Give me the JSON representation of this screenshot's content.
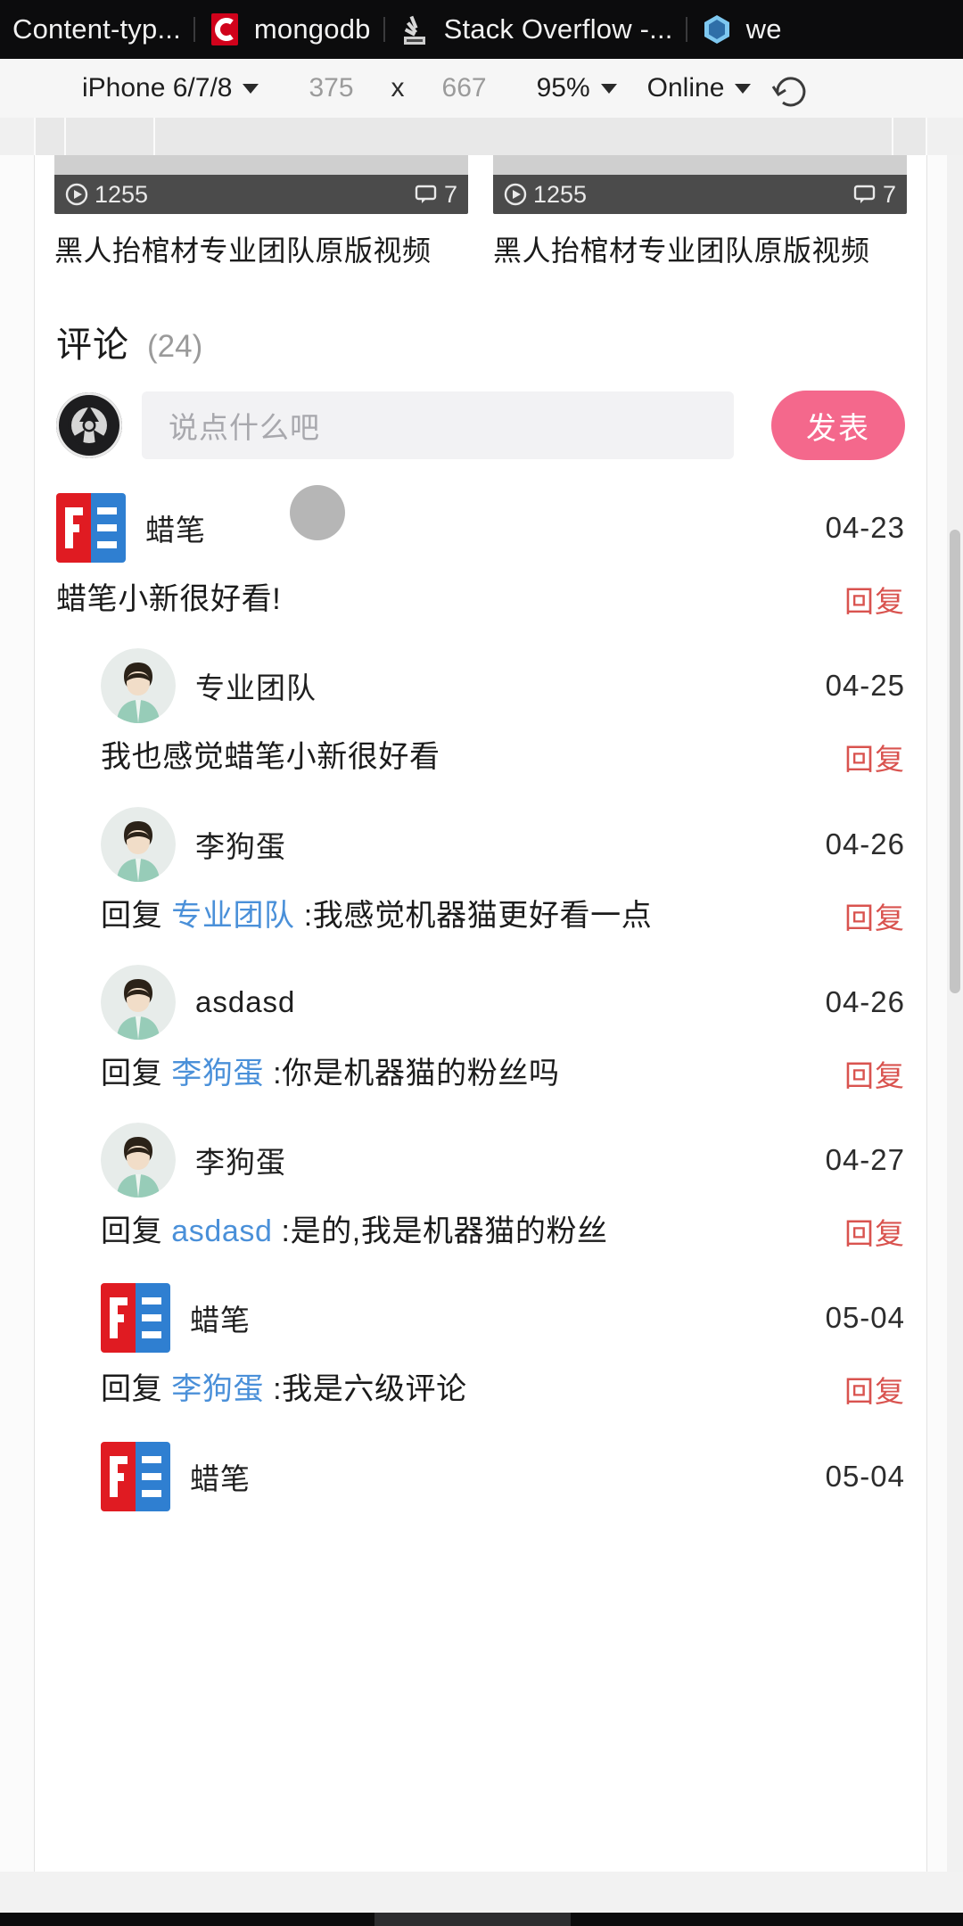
{
  "browser": {
    "tabs": [
      {
        "title": "Content-typ...",
        "favicon": "generic-page-icon"
      },
      {
        "title": "mongodb",
        "favicon": "mongodb-red-c-icon"
      },
      {
        "title": "Stack Overflow -...",
        "favicon": "stack-overflow-icon"
      },
      {
        "title": "we",
        "favicon": "blue-cube-icon"
      }
    ]
  },
  "device_toolbar": {
    "device_label": "iPhone 6/7/8",
    "width": "375",
    "separator": "x",
    "height": "667",
    "zoom": "95%",
    "throttling": "Online",
    "rotate_icon": "rotate-device-icon"
  },
  "page": {
    "videos": [
      {
        "title": "黑人抬棺材专业团队原版视频",
        "plays": "1255",
        "comments": "7"
      },
      {
        "title": "黑人抬棺材专业团队原版视频",
        "plays": "1255",
        "comments": "7"
      }
    ],
    "comments_header": {
      "label": "评论",
      "count": "(24)"
    },
    "composer": {
      "placeholder": "说点什么吧",
      "value": "",
      "submit_label": "发表",
      "submit_color": "#f4688c",
      "avatar": "site-logo-avatar"
    },
    "reply_label": "回复",
    "reply_prefix": "回复",
    "reply_color": "#d9534f",
    "mention_color": "#4a90d9",
    "comments": [
      {
        "level": 0,
        "avatar": "fe-logo-avatar",
        "name": "蜡笔",
        "date": "04-23",
        "prefix": "",
        "mention": "",
        "text": "蜡笔小新很好看!",
        "reply": "回复",
        "loading_dot": true
      },
      {
        "level": 1,
        "avatar": "default-user-avatar",
        "name": "专业团队",
        "date": "04-25",
        "prefix": "",
        "mention": "",
        "text": "我也感觉蜡笔小新很好看",
        "reply": "回复",
        "loading_dot": false
      },
      {
        "level": 1,
        "avatar": "default-user-avatar",
        "name": "李狗蛋",
        "date": "04-26",
        "prefix": "回复",
        "mention": "专业团队",
        "text": ":我感觉机器猫更好看一点",
        "reply": "回复",
        "loading_dot": false
      },
      {
        "level": 1,
        "avatar": "default-user-avatar",
        "name": "asdasd",
        "date": "04-26",
        "prefix": "回复",
        "mention": "李狗蛋",
        "text": ":你是机器猫的粉丝吗",
        "reply": "回复",
        "loading_dot": false
      },
      {
        "level": 1,
        "avatar": "default-user-avatar",
        "name": "李狗蛋",
        "date": "04-27",
        "prefix": "回复",
        "mention": "asdasd",
        "text": ":是的,我是机器猫的粉丝",
        "reply": "回复",
        "loading_dot": false
      },
      {
        "level": 1,
        "avatar": "fe-logo-avatar",
        "name": "蜡笔",
        "date": "05-04",
        "prefix": "回复",
        "mention": "李狗蛋",
        "text": ":我是六级评论",
        "reply": "回复",
        "loading_dot": false
      },
      {
        "level": 1,
        "avatar": "fe-logo-avatar",
        "name": "蜡笔",
        "date": "05-04",
        "prefix": "",
        "mention": "",
        "text": "",
        "reply": "",
        "loading_dot": false
      }
    ]
  }
}
